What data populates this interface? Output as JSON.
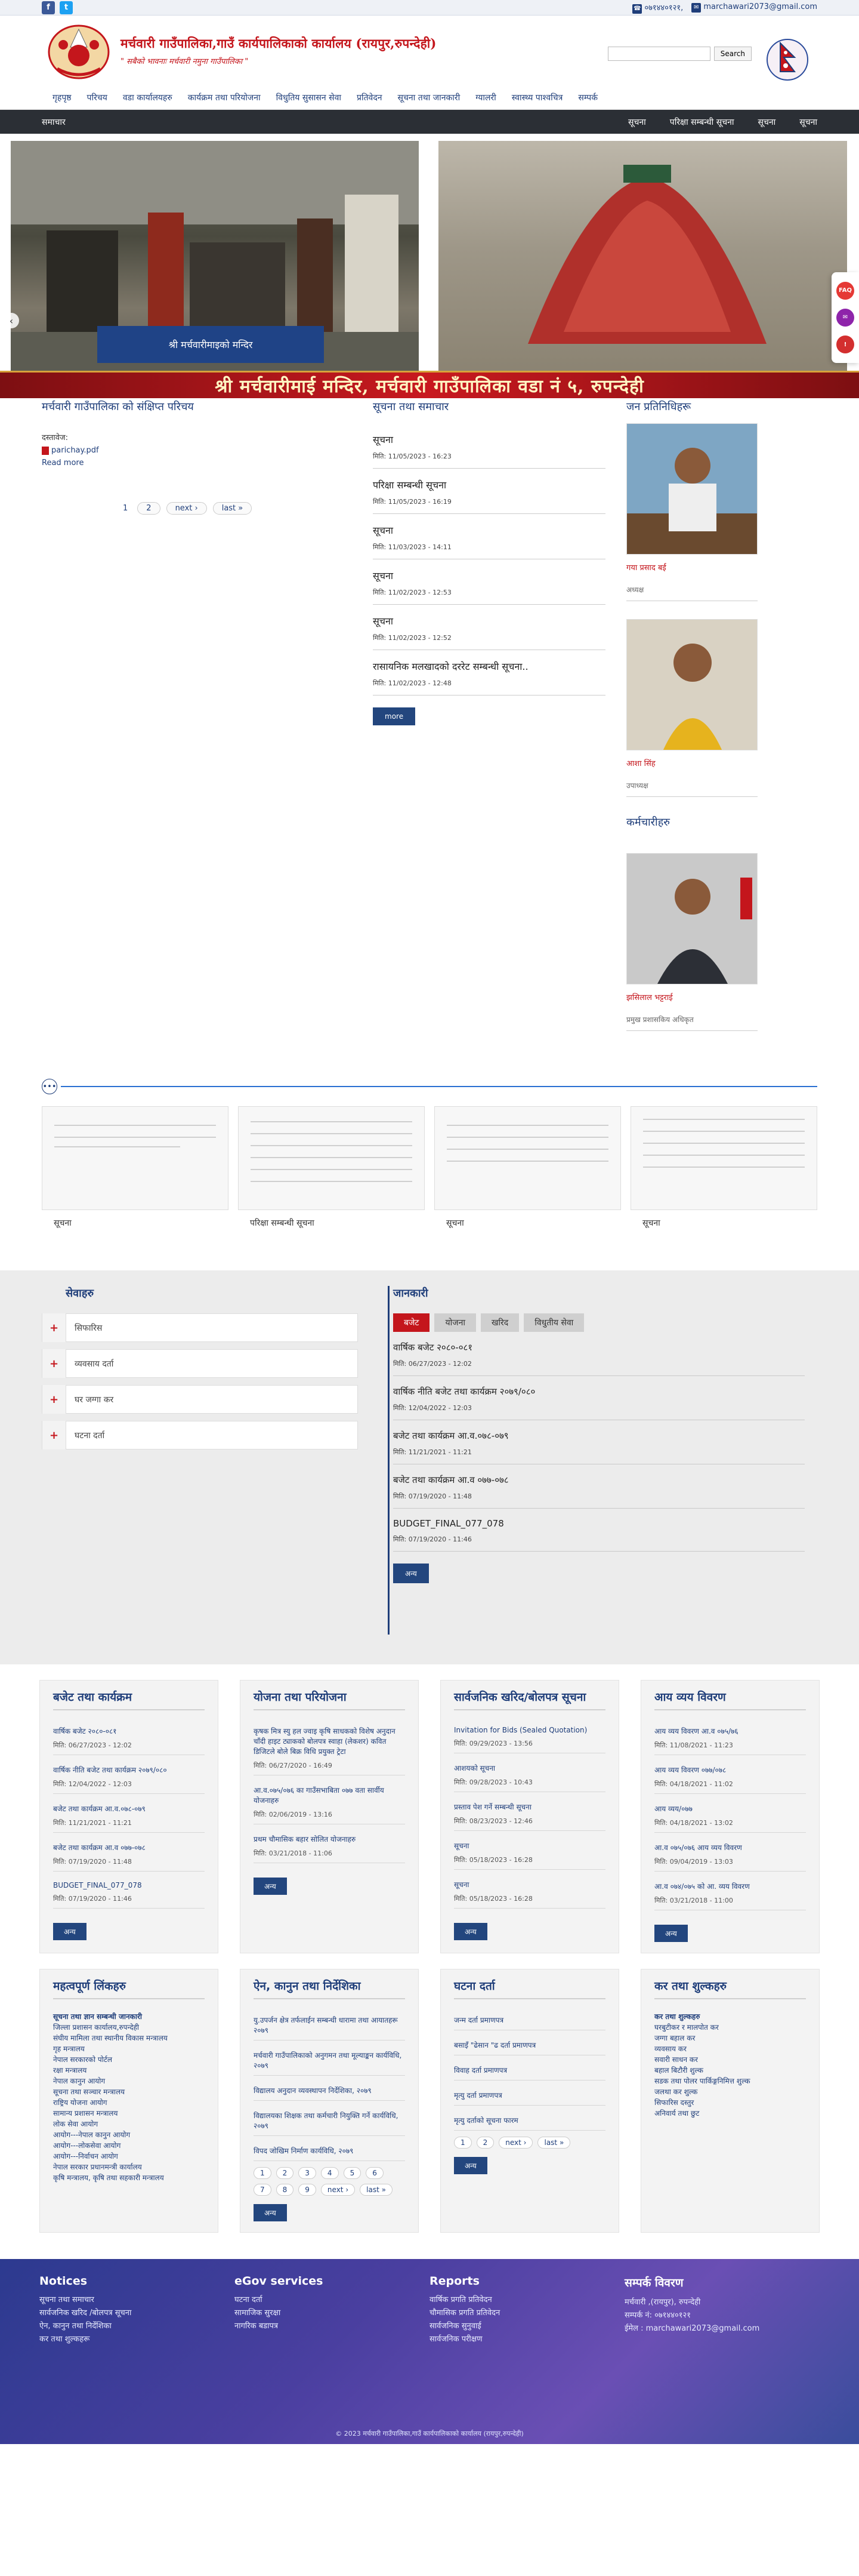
{
  "topbar": {
    "phone": "०७१४४०१२१,",
    "email": "marchawari2073@gmail.com"
  },
  "header": {
    "title": "मर्चवारी गाउँपालिका,गाउँ कार्यपालिकाको कार्यालय (रायपुर,रुपन्देही)",
    "slogan": "\" सबैको भावनाः मर्चवारी नमुना गाउँपालिका \"",
    "search_button": "Search",
    "search_placeholder": ""
  },
  "nav": {
    "items": [
      "गृहपृष्ठ",
      "परिचय",
      "वडा कार्यालयहरु",
      "कार्यक्रम तथा परियोजना",
      "विधुतिय सुसासन सेवा",
      "प्रतिवेदन",
      "सूचना तथा जानकारी",
      "ग्यालरी",
      "स्वास्थ्य पाश्वचित्र",
      "सम्पर्क"
    ]
  },
  "darkbar": {
    "left": "समाचार",
    "right": [
      "सूचना",
      "परिक्षा सम्बन्धी सूचना",
      "सूचना",
      "सूचना"
    ]
  },
  "slider": {
    "caption": "श्री मर्चवारीमाइको मन्दिर",
    "banner": "श्री मर्चवारीमाई मन्दिर, मर्चवारी गाउँपालिका वडा नं ५, रुपन्देही"
  },
  "intro": {
    "title": "मर्चवारी गाउँपालिका को संक्षिप्त परिचय",
    "label": "दस्तावेज:",
    "pdf": "parichay.pdf",
    "readmore": "Read more",
    "pager": [
      "1",
      "2",
      "next ›",
      "last »"
    ]
  },
  "news": {
    "title": "सूचना तथा समाचार",
    "items": [
      {
        "t": "सूचना",
        "d": "मिति: 11/05/2023 - 16:23"
      },
      {
        "t": "परिक्षा सम्बन्धी सूचना",
        "d": "मिति: 11/05/2023 - 16:19"
      },
      {
        "t": "सूचना",
        "d": "मिति: 11/03/2023 - 14:11"
      },
      {
        "t": "सूचना",
        "d": "मिति: 11/02/2023 - 12:53"
      },
      {
        "t": "सूचना",
        "d": "मिति: 11/02/2023 - 12:52"
      },
      {
        "t": "रासायनिक मलखादको दररेट सम्बन्धी सूचना..",
        "d": "मिति: 11/02/2023 - 12:48"
      }
    ],
    "more": "more"
  },
  "reps": {
    "title": "जन प्रतिनिधिहरू",
    "people": [
      {
        "name": "गया प्रसाद बर्ई",
        "role": "अध्यक्ष"
      },
      {
        "name": "आशा सिंह",
        "role": "उपाध्यक्ष"
      }
    ],
    "staff_title": "कर्मचारीहरु",
    "staff": [
      {
        "name": "झसिलाल भट्टराई",
        "role": "प्रमुख प्रशासकिय अधिकृत"
      }
    ]
  },
  "gallery": {
    "items": [
      "सूचना",
      "परिक्षा सम्बन्धी सूचना",
      "सूचना",
      "सूचना"
    ]
  },
  "services": {
    "title": "सेवाहरु",
    "items": [
      "सिफारिस",
      "व्यवसाय दर्ता",
      "घर जग्गा कर",
      "घटना दर्ता"
    ]
  },
  "info": {
    "title": "जानकारी",
    "tabs": [
      "बजेट",
      "योजना",
      "खरिद",
      "विधुतीय सेवा"
    ],
    "items": [
      {
        "t": "वार्षिक बजेट २०८०-०८१",
        "d": "मिति: 06/27/2023 - 12:02"
      },
      {
        "t": "वार्षिक नीति बजेट तथा कार्यक्रम २०७९/०८०",
        "d": "मिति: 12/04/2022 - 12:03"
      },
      {
        "t": "बजेट तथा कार्यक्रम आ.व.०७८-०७९",
        "d": "मिति: 11/21/2021 - 11:21"
      },
      {
        "t": "बजेट तथा कार्यक्रम आ.व ०७७-०७८",
        "d": "मिति: 07/19/2020 - 11:48"
      },
      {
        "t": "BUDGET_FINAL_077_078",
        "d": "मिति: 07/19/2020 - 11:46"
      }
    ],
    "more": "अन्य"
  },
  "cards": [
    {
      "title": "बजेट तथा कार्यक्रम",
      "items": [
        {
          "t": "वार्षिक बजेट २०८०-०८१",
          "d": "मिति: 06/27/2023 - 12:02"
        },
        {
          "t": "वार्षिक नीति बजेट तथा कार्यक्रम २०७९/०८०",
          "d": "मिति: 12/04/2022 - 12:03"
        },
        {
          "t": "बजेट तथा कार्यक्रम आ.व.०७८-०७९",
          "d": "मिति: 11/21/2021 - 11:21"
        },
        {
          "t": "बजेट तथा कार्यक्रम आ.व ०७७-०७८",
          "d": "मिति: 07/19/2020 - 11:48"
        },
        {
          "t": "BUDGET_FINAL_077_078",
          "d": "मिति: 07/19/2020 - 11:46"
        }
      ],
      "more": "अन्य"
    },
    {
      "title": "योजना तथा परियोजना",
      "items": [
        {
          "t": "कृषक मित्र स्यु हल ज्वाइ कृषि साधकको विशेष अनुदान चाँदी हाइट ट्याकको बोलपत्र स्वाहा (लेकशर) कवित डिजिटले बोले बिक्र विधि प्रयुक्त ट्रेटा",
          "d": "मिति: 06/27/2020 - 16:49"
        },
        {
          "t": "आ.व.०७५/०७६ का गाउँसभाबिता ०७७ वता सार्वीय योजनाहरु",
          "d": "मिति: 02/06/2019 - 13:16"
        },
        {
          "t": "प्रथम चौमासिक बहार सोलित योजनाहरु",
          "d": "मिति: 03/21/2018 - 11:06"
        }
      ],
      "more": "अन्य"
    },
    {
      "title": "सार्वजनिक खरिद/बोलपत्र सूचना",
      "items": [
        {
          "t": "Invitation for Bids (Sealed Quotation)",
          "d": "मिति: 09/29/2023 - 13:56"
        },
        {
          "t": "आशयको सूचना",
          "d": "मिति: 09/28/2023 - 10:43"
        },
        {
          "t": "प्रस्ताव पेश गर्ने सम्बन्धी सूचना",
          "d": "मिति: 08/23/2023 - 12:46"
        },
        {
          "t": "सूचना",
          "d": "मिति: 05/18/2023 - 16:28"
        },
        {
          "t": "सूचना",
          "d": "मिति: 05/18/2023 - 16:28"
        }
      ],
      "more": "अन्य"
    },
    {
      "title": "आय व्यय विवरण",
      "items": [
        {
          "t": "आय व्यय विवरण आ.व ०७५/७६",
          "d": "मिति: 11/08/2021 - 11:23"
        },
        {
          "t": "आय व्यय विवरण ०७७/०७८",
          "d": "मिति: 04/18/2021 - 11:02"
        },
        {
          "t": "आय व्यय/०७७",
          "d": "मिति: 04/18/2021 - 13:02"
        },
        {
          "t": "आ.व ०७५/०७६ आय व्यय विवरण",
          "d": "मिति: 09/04/2019 - 13:03"
        },
        {
          "t": "आ.व ०७४/०७५ को आ. व्यय विवरण",
          "d": "मिति: 03/21/2018 - 11:00"
        }
      ],
      "more": "अन्य"
    }
  ],
  "cards2": [
    {
      "title": "महत्वपूर्ण लिंकहरु",
      "head": "सूचना तथा ज्ञान सम्बन्धी जानकारी",
      "links": [
        "जिल्ला प्रशासन कार्यालय,रुपन्देही",
        "संघीय मामिला तथा स्थानीय विकास मन्त्रालय",
        "गृह मन्त्रालय",
        "नेपाल सरकारको पोर्टल",
        "रक्षा मन्त्रालय",
        "नेपाल कानुन आयोग",
        "सूचना तथा सञ्चार मन्त्रालय",
        "राष्ट्रिय योजना आयोग",
        "सामान्य प्रशासन मन्त्रालय",
        "लोक सेवा आयोग",
        "आयोग---नेपाल कानुन आयोग",
        "आयोग---लोकसेवा आयोग",
        "आयोग---निर्वाचन आयोग",
        "नेपाल सरकार प्रधानमन्त्री कार्यालय",
        "कृषि मन्त्रालय, कृषि तथा सहकारी मन्त्रालय"
      ]
    },
    {
      "title": "ऐन, कानुन तथा निर्देशिका",
      "items": [
        {
          "t": "यु.उपर्जन क्षेत्र तर्फलाईन सम्बन्धी धारामा तथा आयातहरू २०७९"
        },
        {
          "t": "मर्चवारी गाउँपालिकाको अनुगमन तथा मूल्याङ्कन कार्यविधि, २०७९"
        },
        {
          "t": "विद्यालय अनुदान व्यवस्थापन निर्देशिका, २०७९"
        },
        {
          "t": "विद्यालयका शिक्षक तथा कर्मचारी नियुक्ति गर्ने कार्यविधि, २०७९"
        },
        {
          "t": "विपद जोखिम निर्माण कार्यविधि, २०७९"
        }
      ],
      "pager": [
        "1",
        "2",
        "3",
        "4",
        "5",
        "6",
        "7",
        "8",
        "9",
        "next ›",
        "last »"
      ],
      "more": "अन्य"
    },
    {
      "title": "घटना दर्ता",
      "items": [
        {
          "t": "जन्म दर्ता प्रमाणपत्र"
        },
        {
          "t": "बसाइँ \"ढेसान \"ढ दर्ता प्रमाणपत्र"
        },
        {
          "t": "विवाह दर्ता प्रमाणपत्र"
        },
        {
          "t": "मृत्यु दर्ता प्रमाणपत्र"
        },
        {
          "t": "मृत्यु दर्ताको सूचना फारम"
        }
      ],
      "pager": [
        "1",
        "2",
        "next ›",
        "last »"
      ],
      "more": "अन्य"
    },
    {
      "title": "कर तथा शुल्कहरु",
      "links": [
        "कर तथा शुल्कहरु",
        "घरबुटीकर र मालपोत कर",
        "जग्गा बहाल कर",
        "व्यवसाय कर",
        "सवारी साधन कर",
        "बहाल बिटौरी शुल्क",
        "सडक तथा पोलर पार्किङ्गनिमित्त शुल्क",
        "जलथा कर शुल्क",
        "सिफारिस दस्तुर",
        "अनिवार्य तथा छुट"
      ]
    }
  ],
  "footer": {
    "cols": [
      {
        "title": "Notices",
        "links": [
          "सूचना तथा समाचार",
          "सार्वजनिक खरिद /बोलपत्र सूचना",
          "ऐन, कानुन तथा निर्देशिका",
          "कर तथा शुल्कहरू"
        ]
      },
      {
        "title": "eGov services",
        "links": [
          "घटना दर्ता",
          "सामाजिक सुरक्षा",
          "नागरिक बडापत्र"
        ]
      },
      {
        "title": "Reports",
        "links": [
          "वार्षिक प्रगति प्रतिवेदन",
          "चौमासिक प्रगति प्रतिवेदन",
          "सार्वजनिक सुनुवाई",
          "सार्वजनिक परीक्षण"
        ]
      },
      {
        "title": "सम्पर्क विवरण",
        "links": [
          "मर्चवारी ,(रायपुर), रुपन्देही",
          "सम्पर्क नं: ०७१४४०१२१",
          "ईमेल : marchawari2073@gmail.com"
        ]
      }
    ],
    "copyright": "© 2023 मर्चवारी गाउँपालिका,गाउँ कार्यपालिकाको कार्यालय (रायपुर,रुपन्देही)"
  }
}
